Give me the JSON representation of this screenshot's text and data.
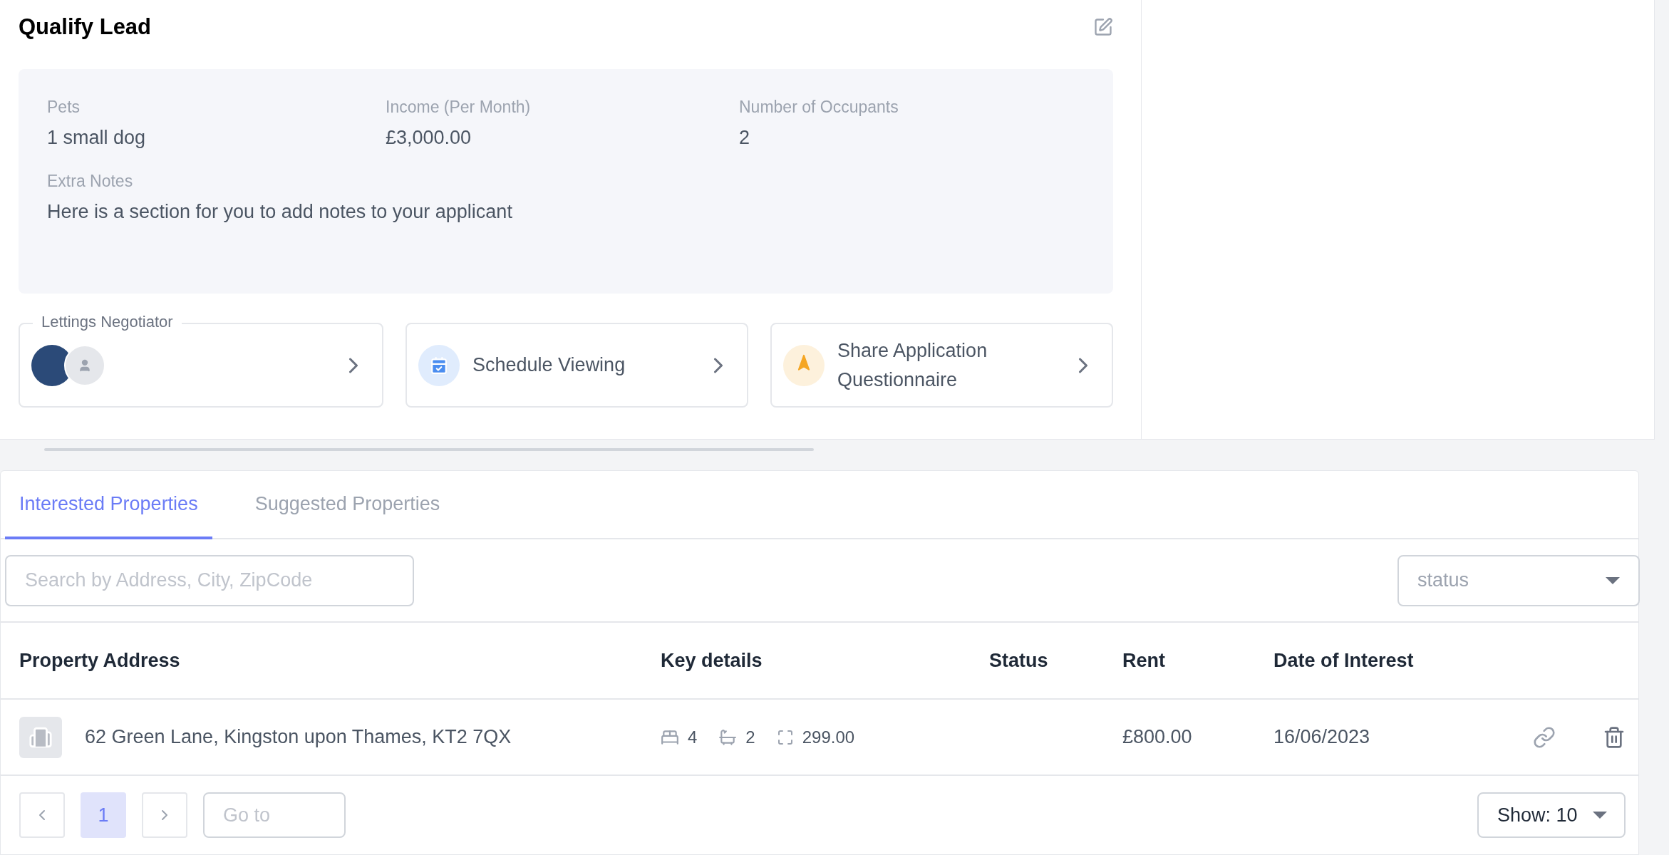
{
  "panel": {
    "title": "Qualify Lead",
    "fields": [
      {
        "label": "Pets",
        "value": "1 small dog"
      },
      {
        "label": "Income (Per Month)",
        "value": "£3,000.00"
      },
      {
        "label": "Number of Occupants",
        "value": "2"
      }
    ],
    "notes": {
      "label": "Extra Notes",
      "value": "Here is a section for you to add notes to your applicant"
    },
    "actions": [
      {
        "kind": "negotiator",
        "label": "Lettings Negotiator"
      },
      {
        "kind": "viewing",
        "label": "Schedule Viewing"
      },
      {
        "kind": "share",
        "label": "Share Application Questionnaire"
      }
    ]
  },
  "tabs": [
    {
      "label": "Interested Properties",
      "selected": true
    },
    {
      "label": "Suggested Properties",
      "selected": false
    }
  ],
  "search": {
    "placeholder": "Search by Address, City, ZipCode"
  },
  "status_filter": {
    "placeholder": "status"
  },
  "table": {
    "columns": [
      "Property Address",
      "Key details",
      "Status",
      "Rent",
      "Date of Interest"
    ],
    "rows": [
      {
        "address": "62 Green Lane, Kingston upon Thames, KT2 7QX",
        "beds": "4",
        "baths": "2",
        "area": "299.00",
        "rent": "£800.00",
        "date": "16/06/2023"
      }
    ]
  },
  "pagination": {
    "pages": [
      {
        "label": "1",
        "selected": true
      }
    ],
    "goto": {
      "placeholder": "Go to"
    },
    "page_size": "Show: 10"
  }
}
